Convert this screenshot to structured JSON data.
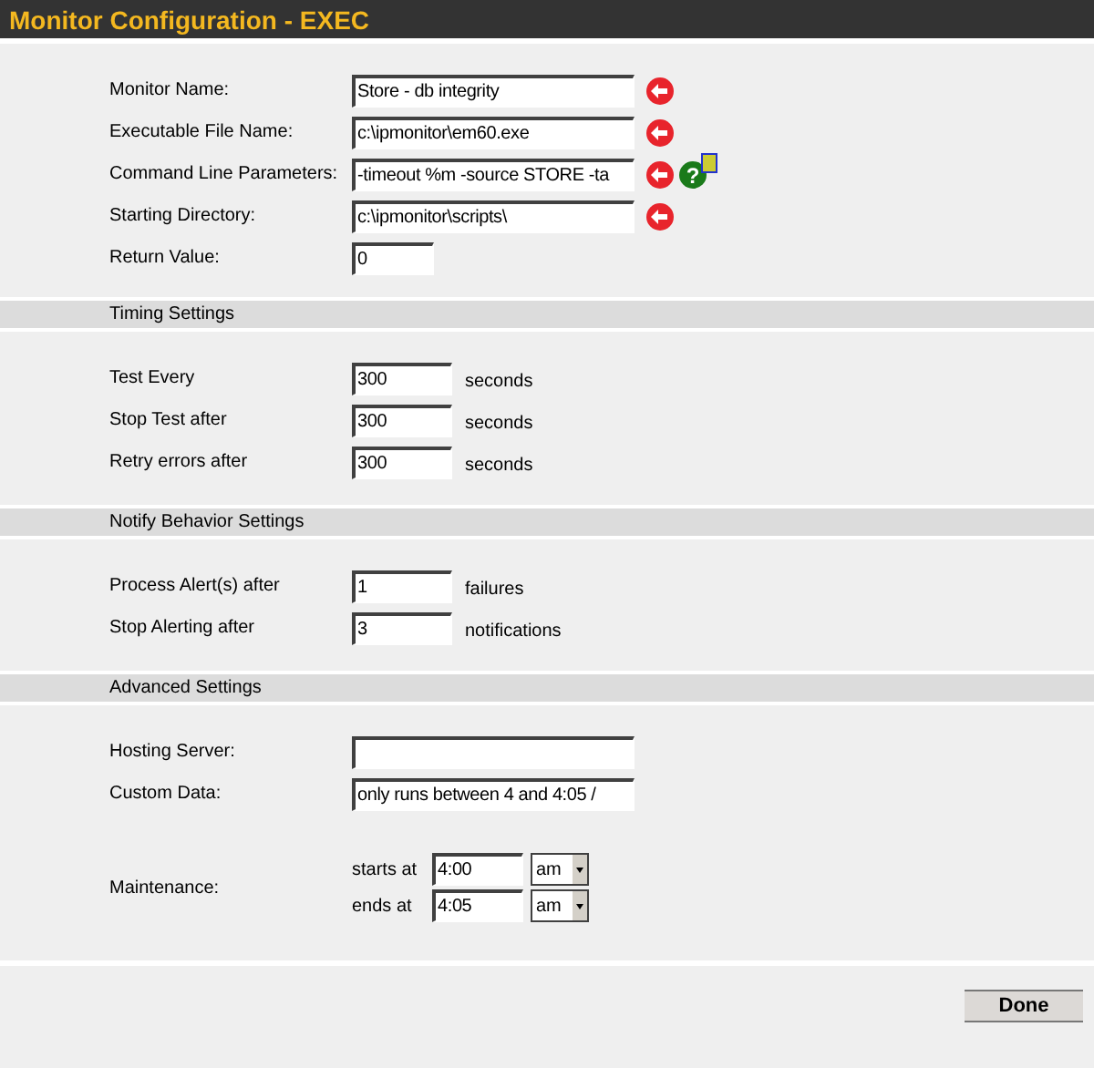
{
  "window": {
    "title": "Monitor Configuration - EXEC"
  },
  "sections": [
    {
      "rows": [
        {
          "label": "Monitor Name:",
          "kind": "long",
          "value": "Store - db integrity",
          "required": true
        },
        {
          "label": "Executable File Name:",
          "kind": "long",
          "value": "c:\\ipmonitor\\em60.exe",
          "required": true
        },
        {
          "label": "Command Line Parameters:",
          "kind": "long",
          "value": "-timeout %m -source STORE -ta",
          "required": true,
          "help": "?"
        },
        {
          "label": "Starting Directory:",
          "kind": "long",
          "value": "c:\\ipmonitor\\scripts\\",
          "required": true
        },
        {
          "label": "Return Value:",
          "kind": "number",
          "value": "0",
          "required": false
        }
      ]
    },
    {
      "heading": "Timing Settings",
      "rows": [
        {
          "label": "Test Every",
          "kind": "short",
          "value": "300",
          "unit": "seconds"
        },
        {
          "label": "Stop Test after",
          "kind": "short",
          "value": "300",
          "unit": "seconds"
        },
        {
          "label": "Retry errors after",
          "kind": "short",
          "value": "300",
          "unit": "seconds"
        }
      ]
    },
    {
      "heading": "Notify Behavior Settings",
      "rows": [
        {
          "label": "Process Alert(s) after",
          "kind": "short",
          "value": "1",
          "unit": "failures"
        },
        {
          "label": "Stop Alerting after",
          "kind": "short",
          "value": "3",
          "unit": "notifications"
        }
      ]
    },
    {
      "heading": "Advanced Settings",
      "rows": [
        {
          "label": "Hosting Server:",
          "kind": "long"
        },
        {
          "label": "Custom Data:",
          "kind": "long",
          "value": "only runs between 4 and 4:05 /"
        },
        {
          "label": "Maintenance:",
          "kind": "schedule",
          "times": [
            {
              "label": "starts at",
              "value": "4:00",
              "period": "am"
            },
            {
              "label": "ends at",
              "value": "4:05",
              "period": "am"
            }
          ]
        }
      ]
    }
  ],
  "buttons": [
    "Done"
  ]
}
